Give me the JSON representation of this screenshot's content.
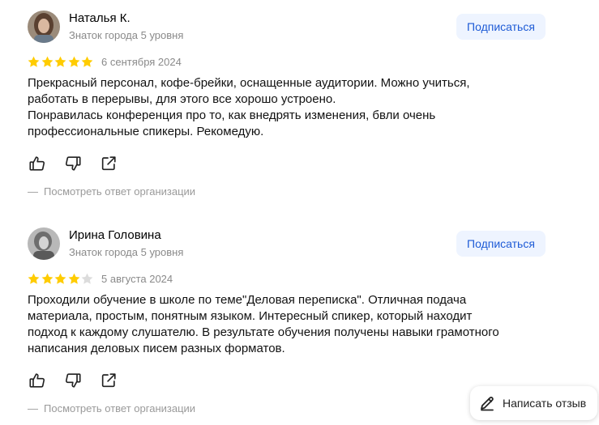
{
  "reviews": [
    {
      "author": "Наталья К.",
      "level": "Знаток города 5 уровня",
      "subscribe_label": "Подписаться",
      "rating": 5,
      "date": "6 сентября 2024",
      "text_lines": [
        "Прекрасный персонал, кофе-брейки, оснащенные аудитории. Можно учиться, работать в перерывы, для этого все хорошо устроено.",
        "Понравилась конференция про то, как внедрять изменения, бвли очень профессиональные спикеры. Рекомедую."
      ],
      "org_reply_dash": "—",
      "org_reply_label": "Посмотреть ответ организации"
    },
    {
      "author": "Ирина Головина",
      "level": "Знаток города 5 уровня",
      "subscribe_label": "Подписаться",
      "rating": 4,
      "date": "5 августа 2024",
      "text_lines": [
        "Проходили обучение в школе по теме\"Деловая переписка\". Отличная подача материала, простым, понятным языком. Интересный спикер, который находит подход к каждому слушателю. В результате обучения получены навыки грамотного написания деловых писем разных форматов."
      ],
      "org_reply_dash": "—",
      "org_reply_label": "Посмотреть ответ организации"
    }
  ],
  "write_review_label": "Написать отзыв",
  "colors": {
    "star_filled": "#ffcc00",
    "star_empty": "#dcdcdc",
    "subscribe_bg": "#eef4ff",
    "subscribe_text": "#1e5bd6",
    "muted_text": "#8a8a8a"
  },
  "icons": [
    "thumbs-up-icon",
    "thumbs-down-icon",
    "share-icon",
    "pencil-icon",
    "star-icon"
  ]
}
